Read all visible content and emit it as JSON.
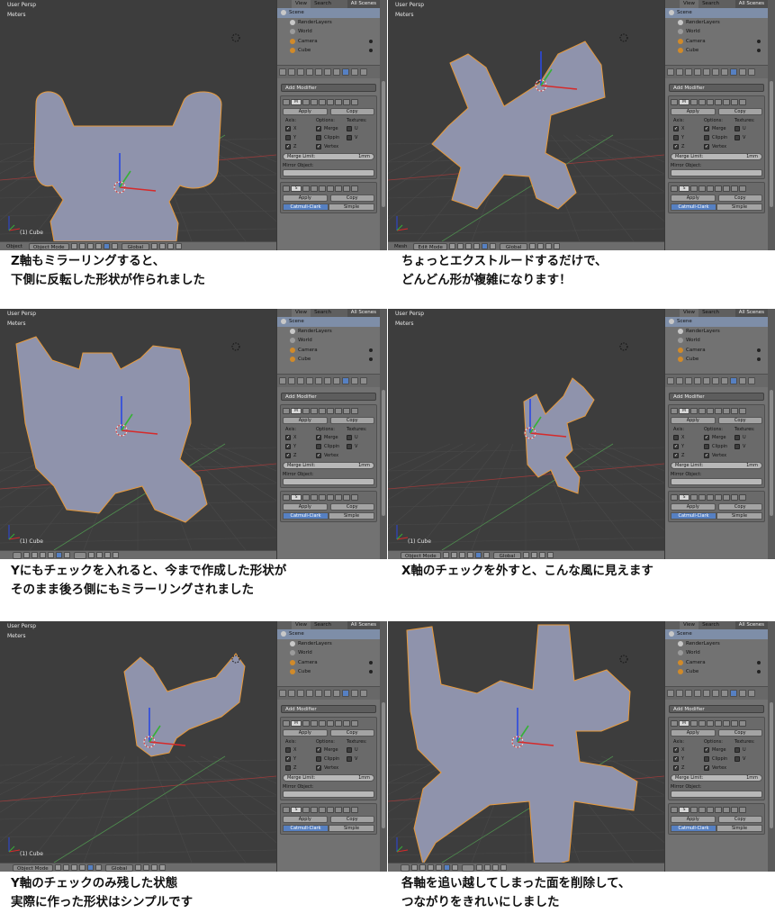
{
  "panels": [
    {
      "view_title": "User Persp",
      "units": "Meters",
      "object_label": "(1) Cube",
      "header": {
        "menu": "Object",
        "mode": "Object Mode",
        "orientation": "Global"
      },
      "outliner": {
        "tabs": [
          "View",
          "Search",
          "All Scenes"
        ],
        "items": [
          "Scene",
          "RenderLayers",
          "World",
          "Camera",
          "Cube"
        ]
      },
      "properties": {
        "add_modifier": "Add Modifier",
        "mirror": {
          "apply": "Apply",
          "copy": "Copy",
          "axis_header": "Axis:",
          "options_header": "Options:",
          "textures_header": "Textures:",
          "rows": [
            {
              "axis": "X",
              "axis_checked": true,
              "option": "Merge",
              "option_checked": true,
              "texture": "U",
              "texture_checked": false
            },
            {
              "axis": "Y",
              "axis_checked": false,
              "option": "Clippin",
              "option_checked": false,
              "texture": "V",
              "texture_checked": false
            },
            {
              "axis": "Z",
              "axis_checked": true,
              "option": "Vertex",
              "option_checked": true,
              "texture": "",
              "texture_checked": false
            }
          ],
          "merge_limit_label": "Merge Limit:",
          "merge_limit_value": "1mm",
          "mirror_object_label": "Mirror Object:"
        },
        "subsurf": {
          "apply": "Apply",
          "copy": "Copy",
          "tab_active": "Catmull-Clark",
          "tab_other": "Simple"
        }
      }
    },
    {
      "view_title": "User Persp",
      "units": "Meters",
      "object_label": "",
      "header": {
        "menu": "Mesh",
        "mode": "Edit Mode",
        "orientation": "Global"
      },
      "outliner": {
        "tabs": [
          "View",
          "Search",
          "All Scenes"
        ],
        "items": [
          "Scene",
          "RenderLayers",
          "World",
          "Camera",
          "Cube"
        ]
      },
      "properties": {
        "add_modifier": "Add Modifier",
        "mirror": {
          "apply": "Apply",
          "copy": "Copy",
          "axis_header": "Axis:",
          "options_header": "Options:",
          "textures_header": "Textures:",
          "rows": [
            {
              "axis": "X",
              "axis_checked": true,
              "option": "Merge",
              "option_checked": true,
              "texture": "U",
              "texture_checked": false
            },
            {
              "axis": "Y",
              "axis_checked": false,
              "option": "Clippin",
              "option_checked": false,
              "texture": "V",
              "texture_checked": false
            },
            {
              "axis": "Z",
              "axis_checked": true,
              "option": "Vertex",
              "option_checked": true,
              "texture": "",
              "texture_checked": false
            }
          ],
          "merge_limit_label": "Merge Limit:",
          "merge_limit_value": "1mm",
          "mirror_object_label": "Mirror Object:"
        },
        "subsurf": {
          "apply": "Apply",
          "copy": "Copy",
          "tab_active": "Catmull-Clark",
          "tab_other": "Simple"
        }
      }
    },
    {
      "view_title": "User Persp",
      "units": "Meters",
      "object_label": "(1) Cube",
      "header": {
        "menu": "",
        "mode": "",
        "orientation": ""
      },
      "outliner": {
        "tabs": [
          "View",
          "Search",
          "All Scenes"
        ],
        "items": [
          "Scene",
          "RenderLayers",
          "World",
          "Camera",
          "Cube"
        ]
      },
      "properties": {
        "add_modifier": "Add Modifier",
        "mirror": {
          "apply": "Apply",
          "copy": "Copy",
          "axis_header": "Axis:",
          "options_header": "Options:",
          "textures_header": "Textures:",
          "rows": [
            {
              "axis": "X",
              "axis_checked": true,
              "option": "Merge",
              "option_checked": true,
              "texture": "U",
              "texture_checked": false
            },
            {
              "axis": "Y",
              "axis_checked": true,
              "option": "Clippin",
              "option_checked": false,
              "texture": "V",
              "texture_checked": false
            },
            {
              "axis": "Z",
              "axis_checked": true,
              "option": "Vertex",
              "option_checked": true,
              "texture": "",
              "texture_checked": false
            }
          ],
          "merge_limit_label": "Merge Limit:",
          "merge_limit_value": "1mm",
          "mirror_object_label": "Mirror Object:"
        },
        "subsurf": {
          "apply": "Apply",
          "copy": "Copy",
          "tab_active": "Catmull-Clark",
          "tab_other": "Simple"
        }
      }
    },
    {
      "view_title": "User Persp",
      "units": "Meters",
      "object_label": "(1) Cube",
      "header": {
        "menu": "",
        "mode": "Object Mode",
        "orientation": "Global"
      },
      "outliner": {
        "tabs": [
          "View",
          "Search",
          "All Scenes"
        ],
        "items": [
          "Scene",
          "RenderLayers",
          "World",
          "Camera",
          "Cube"
        ]
      },
      "properties": {
        "add_modifier": "Add Modifier",
        "mirror": {
          "apply": "Apply",
          "copy": "Copy",
          "axis_header": "Axis:",
          "options_header": "Options:",
          "textures_header": "Textures:",
          "rows": [
            {
              "axis": "X",
              "axis_checked": false,
              "option": "Merge",
              "option_checked": true,
              "texture": "U",
              "texture_checked": false
            },
            {
              "axis": "Y",
              "axis_checked": true,
              "option": "Clippin",
              "option_checked": false,
              "texture": "V",
              "texture_checked": false
            },
            {
              "axis": "Z",
              "axis_checked": true,
              "option": "Vertex",
              "option_checked": true,
              "texture": "",
              "texture_checked": false
            }
          ],
          "merge_limit_label": "Merge Limit:",
          "merge_limit_value": "1mm",
          "mirror_object_label": "Mirror Object:"
        },
        "subsurf": {
          "apply": "Apply",
          "copy": "Copy",
          "tab_active": "Catmull-Clark",
          "tab_other": "Simple"
        }
      }
    },
    {
      "view_title": "User Persp",
      "units": "Meters",
      "object_label": "(1) Cube",
      "header": {
        "menu": "",
        "mode": "Object Mode",
        "orientation": "Global"
      },
      "outliner": {
        "tabs": [
          "View",
          "Search",
          "All Scenes"
        ],
        "items": [
          "Scene",
          "RenderLayers",
          "World",
          "Camera",
          "Cube"
        ]
      },
      "properties": {
        "add_modifier": "Add Modifier",
        "mirror": {
          "apply": "Apply",
          "copy": "Copy",
          "axis_header": "Axis:",
          "options_header": "Options:",
          "textures_header": "Textures:",
          "rows": [
            {
              "axis": "X",
              "axis_checked": false,
              "option": "Merge",
              "option_checked": true,
              "texture": "U",
              "texture_checked": false
            },
            {
              "axis": "Y",
              "axis_checked": true,
              "option": "Clippin",
              "option_checked": false,
              "texture": "V",
              "texture_checked": false
            },
            {
              "axis": "Z",
              "axis_checked": false,
              "option": "Vertex",
              "option_checked": true,
              "texture": "",
              "texture_checked": false
            }
          ],
          "merge_limit_label": "Merge Limit:",
          "merge_limit_value": "1mm",
          "mirror_object_label": "Mirror Object:"
        },
        "subsurf": {
          "apply": "Apply",
          "copy": "Copy",
          "tab_active": "Catmull-Clark",
          "tab_other": "Simple"
        }
      }
    },
    {
      "view_title": "",
      "units": "",
      "object_label": "",
      "header": {
        "menu": "",
        "mode": "",
        "orientation": ""
      },
      "outliner": {
        "tabs": [
          "View",
          "Search",
          "All Scenes"
        ],
        "items": [
          "Scene",
          "RenderLayers",
          "World",
          "Camera",
          "Cube"
        ]
      },
      "properties": {
        "add_modifier": "Add Modifier",
        "mirror": {
          "apply": "Apply",
          "copy": "Copy",
          "axis_header": "Axis:",
          "options_header": "Options:",
          "textures_header": "Textures:",
          "rows": [
            {
              "axis": "X",
              "axis_checked": true,
              "option": "Merge",
              "option_checked": true,
              "texture": "U",
              "texture_checked": false
            },
            {
              "axis": "Y",
              "axis_checked": true,
              "option": "Clippin",
              "option_checked": false,
              "texture": "V",
              "texture_checked": false
            },
            {
              "axis": "Z",
              "axis_checked": true,
              "option": "Vertex",
              "option_checked": true,
              "texture": "",
              "texture_checked": false
            }
          ],
          "merge_limit_label": "Merge Limit:",
          "merge_limit_value": "1mm",
          "mirror_object_label": "Mirror Object:"
        },
        "subsurf": {
          "apply": "Apply",
          "copy": "Copy",
          "tab_active": "Catmull-Clark",
          "tab_other": "Simple"
        }
      }
    }
  ],
  "captions": [
    {
      "line1": "Z軸もミラーリングすると、",
      "line2": "下側に反転した形状が作られました"
    },
    {
      "line1": "ちょっとエクストルードするだけで、",
      "line2": "どんどん形が複雑になります！"
    },
    {
      "line1": "Yにもチェックを入れると、今まで作成した形状が",
      "line2": "そのまま後ろ側にもミラーリングされました"
    },
    {
      "line1": "X軸のチェックを外すと、こんな風に見えます",
      "line2": ""
    },
    {
      "line1": "Y軸のチェックのみ残した状態",
      "line2": "実際に作った形状はシンプルです"
    },
    {
      "line1": "各軸を追い越してしまった面を削除して、",
      "line2": "つながりをきれいにしました"
    }
  ],
  "colors": {
    "viewport_bg": "#3d3d3d",
    "mesh_fill": "#8f93ac",
    "selection_outline": "#e89a3a",
    "axis_x": "#d62a2a",
    "axis_y": "#36b036",
    "axis_z": "#2a48e0",
    "active_tab": "#5680c2"
  }
}
